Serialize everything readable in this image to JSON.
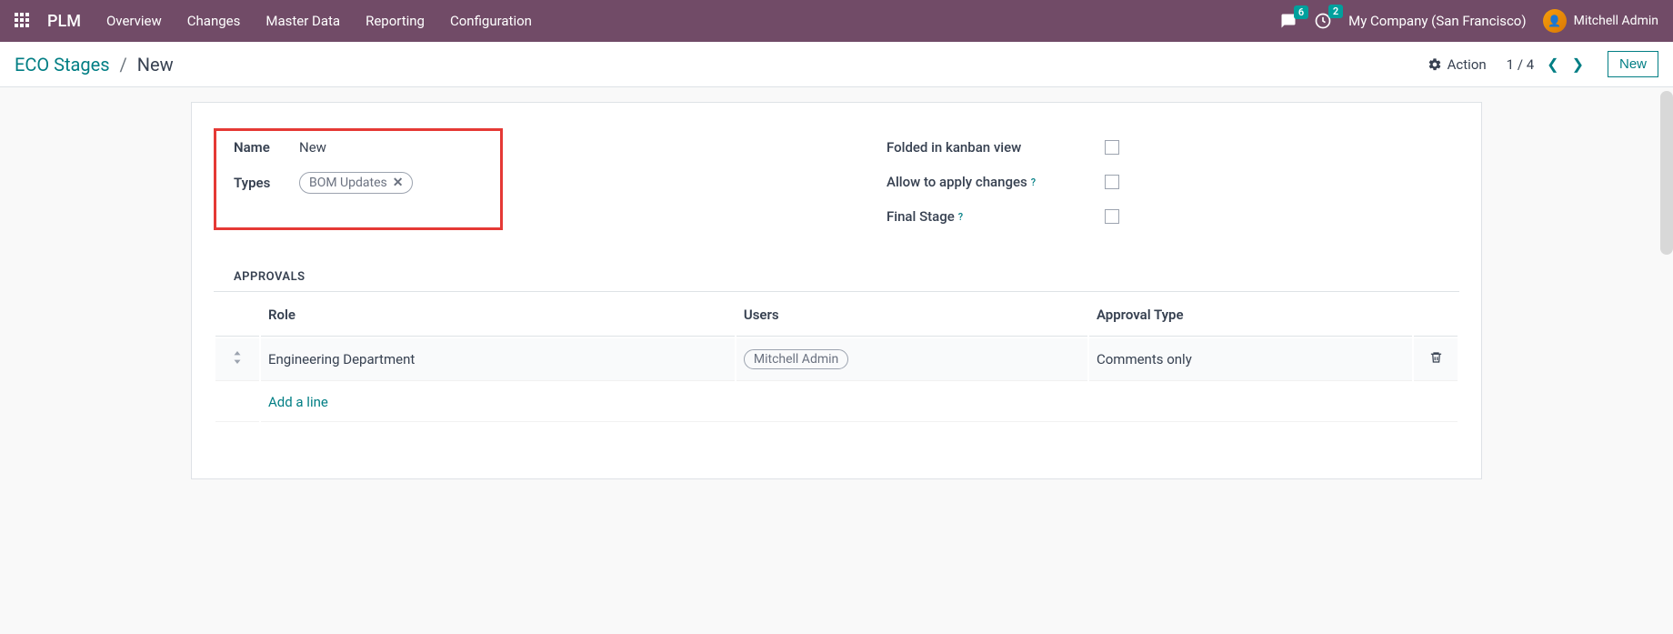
{
  "topnav": {
    "app": "PLM",
    "items": [
      "Overview",
      "Changes",
      "Master Data",
      "Reporting",
      "Configuration"
    ],
    "messages_badge": "6",
    "activity_badge": "2",
    "company": "My Company (San Francisco)",
    "user": "Mitchell Admin"
  },
  "breadcrumb": {
    "parent": "ECO Stages",
    "current": "New",
    "action_label": "Action",
    "pager": "1 / 4",
    "new_label": "New"
  },
  "form": {
    "name_label": "Name",
    "name_value": "New",
    "types_label": "Types",
    "types_tag": "BOM Updates",
    "folded_label": "Folded in kanban view",
    "allow_label": "Allow to apply changes",
    "final_label": "Final Stage"
  },
  "approvals": {
    "section": "APPROVALS",
    "columns": {
      "role": "Role",
      "users": "Users",
      "approval_type": "Approval Type"
    },
    "rows": [
      {
        "role": "Engineering Department",
        "user": "Mitchell Admin",
        "approval_type": "Comments only"
      }
    ],
    "add_line": "Add a line"
  }
}
